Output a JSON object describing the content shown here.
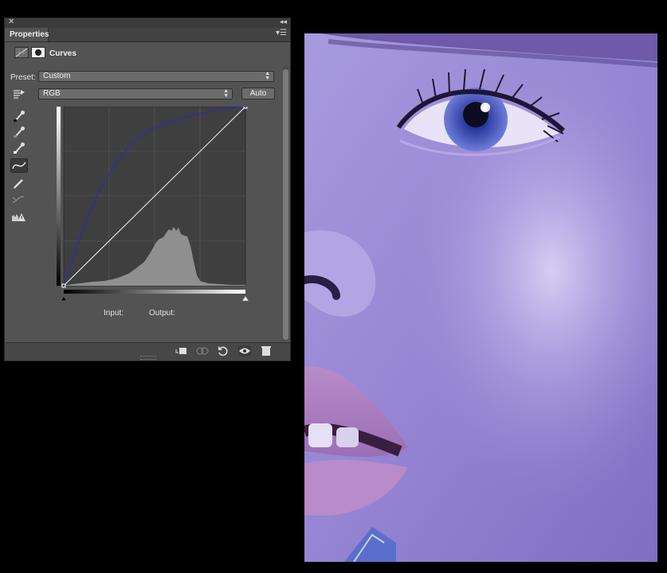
{
  "panel": {
    "tab_label": "Properties",
    "header_title": "Curves",
    "preset_label": "Preset:",
    "preset_value": "Custom",
    "channel_value": "RGB",
    "auto_label": "Auto",
    "input_label": "Input:",
    "output_label": "Output:"
  },
  "tools": [
    "on-image-adjust-icon",
    "black-point-eyedropper-icon",
    "gray-point-eyedropper-icon",
    "white-point-eyedropper-icon",
    "edit-points-curve-icon",
    "pencil-draw-icon",
    "smooth-curve-icon",
    "clipping-warning-icon"
  ],
  "bottom_icons": [
    "clip-to-layer-icon",
    "view-previous-state-icon",
    "reset-icon",
    "visibility-eye-icon",
    "delete-trash-icon"
  ],
  "curve": {
    "input_range": [
      0,
      255
    ],
    "output_range": [
      0,
      255
    ],
    "points": [
      [
        0,
        0
      ],
      [
        255,
        255
      ]
    ],
    "curve_color": "#2b2fa8"
  },
  "colors": {
    "panel_bg": "#535353",
    "graph_bg": "#3f3f3f",
    "image_tint": "#8b7fd6"
  }
}
